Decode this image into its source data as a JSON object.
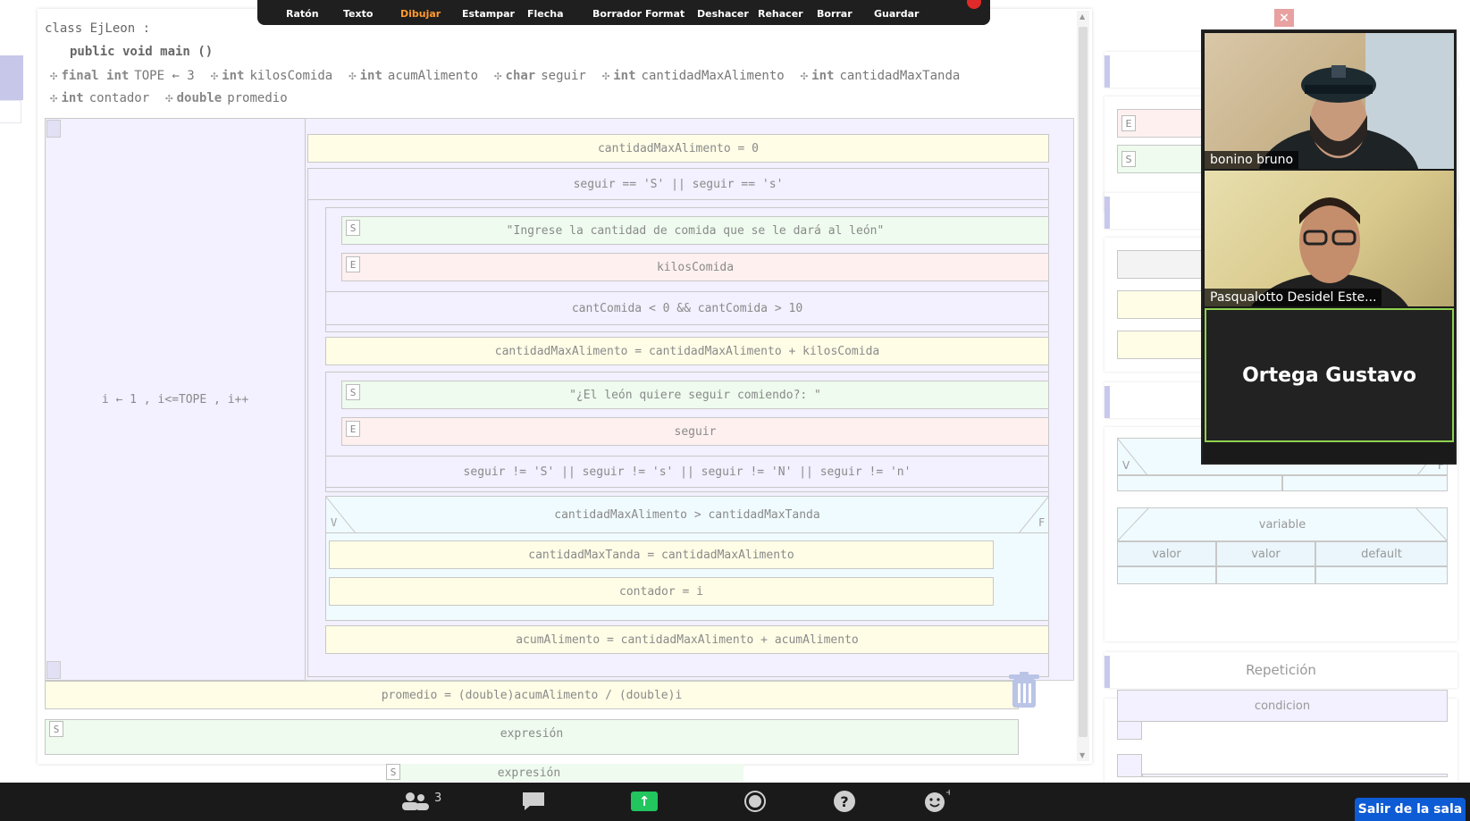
{
  "toolbar": {
    "items": [
      "Ratón",
      "Texto",
      "Dibujar",
      "Estampar",
      "Flecha",
      "Borrador",
      "Format",
      "Deshacer",
      "Rehacer",
      "Borrar",
      "Guardar"
    ],
    "active": "Dibujar",
    "accent": "#ff9a2e"
  },
  "editor": {
    "class_line": "class EjLeon :",
    "method_line": "public void main ()",
    "declarations_row1": [
      {
        "kw": "final int",
        "name": "TOPE ← 3"
      },
      {
        "kw": "int",
        "name": "kilosComida"
      },
      {
        "kw": "int",
        "name": "acumAlimento"
      },
      {
        "kw": "char",
        "name": "seguir"
      },
      {
        "kw": "int",
        "name": "cantidadMaxAlimento"
      },
      {
        "kw": "int",
        "name": "cantidadMaxTanda"
      }
    ],
    "declarations_row2": [
      {
        "kw": "int",
        "name": "contador"
      },
      {
        "kw": "double",
        "name": "promedio"
      }
    ],
    "for_header": "i ← 1 , i<=TOPE , i++",
    "b1": "cantidadMaxAlimento = 0",
    "while_cond": "seguir == 'S' || seguir == 's'",
    "s1_tag": "S",
    "s1": "\"Ingrese la cantidad de comida que se le dará al león\"",
    "e1_tag": "E",
    "e1": "kilosComida",
    "until1": "cantComida < 0 && cantComida > 10",
    "b2": "cantidadMaxAlimento = cantidadMaxAlimento + kilosComida",
    "s2_tag": "S",
    "s2": "\"¿El león quiere seguir comiendo?: \"",
    "e2_tag": "E",
    "e2": "seguir",
    "until2": "seguir != 'S' || seguir != 's' || seguir != 'N' || seguir != 'n'",
    "if_cond": "cantidadMaxAlimento > cantidadMaxTanda",
    "if_v": "V",
    "if_f": "F",
    "then1": "cantidadMaxTanda = cantidadMaxAlimento",
    "then2": "contador = i",
    "b3": "acumAlimento = cantidadMaxAlimento + acumAlimento",
    "promedio": "promedio = (double)acumAlimento / (double)i",
    "s3_tag": "S",
    "s3": "expresión",
    "s4_tag": "S",
    "s4": "expresión"
  },
  "palette": {
    "tag_e": "E",
    "tag_s": "S",
    "cond_label": "condicion",
    "cond_v": "V",
    "cond_f": "F",
    "switch_var": "variable",
    "switch_cases": [
      "valor",
      "valor",
      "default"
    ],
    "repeticion": "Repetición",
    "rep_cond": "condicion"
  },
  "video": {
    "participants": [
      {
        "name": "bonino bruno"
      },
      {
        "name": "Pasqualotto Desidel Este..."
      },
      {
        "name": "Ortega Gustavo"
      }
    ],
    "close": "×"
  },
  "bottombar": {
    "participants_count": "3",
    "leave_label": "Salir de la sala",
    "share_color": "#22c55e"
  }
}
